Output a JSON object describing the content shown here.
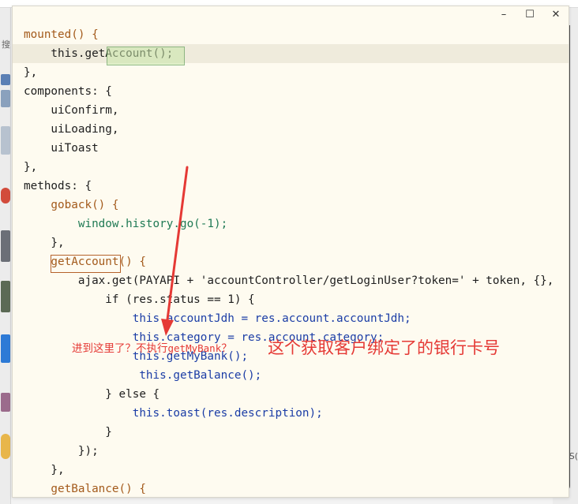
{
  "background": {
    "left_char": "搜",
    "right_char": "S("
  },
  "window": {
    "minimize_icon": "minimize-icon",
    "maximize_icon": "maximize-icon",
    "close_icon": "close-icon",
    "minimize_glyph": "–",
    "maximize_glyph": "☐",
    "close_glyph": "✕"
  },
  "code_lines": [
    "mounted() {",
    "    this.getAccount();",
    "},",
    "components: {",
    "    uiConfirm,",
    "    uiLoading,",
    "    uiToast",
    "},",
    "methods: {",
    "    goback() {",
    "        window.history.go(-1);",
    "    },",
    "    getAccount() {",
    "        ajax.get(PAYAPI + 'accountController/getLoginUser?token=' + token, {},",
    "            if (res.status == 1) {",
    "                this.accountJdh = res.account.accountJdh;",
    "                this.category = res.account.category;",
    "                this.getMyBank();",
    "                 this.getBalance();",
    "            } else {",
    "                this.toast(res.description);",
    "            }",
    "        });",
    "    },",
    "    getBalance() {"
  ],
  "annotations": {
    "small_prefix": "进到这里了？不执行",
    "small_code": "getMyBank",
    "small_suffix": "？",
    "big": "这个获取客户绑定了的银行卡号"
  },
  "colors": {
    "editor_bg": "#fefbf0",
    "annotation_red": "#e53935",
    "highlight_green": "#c8e6a8"
  }
}
